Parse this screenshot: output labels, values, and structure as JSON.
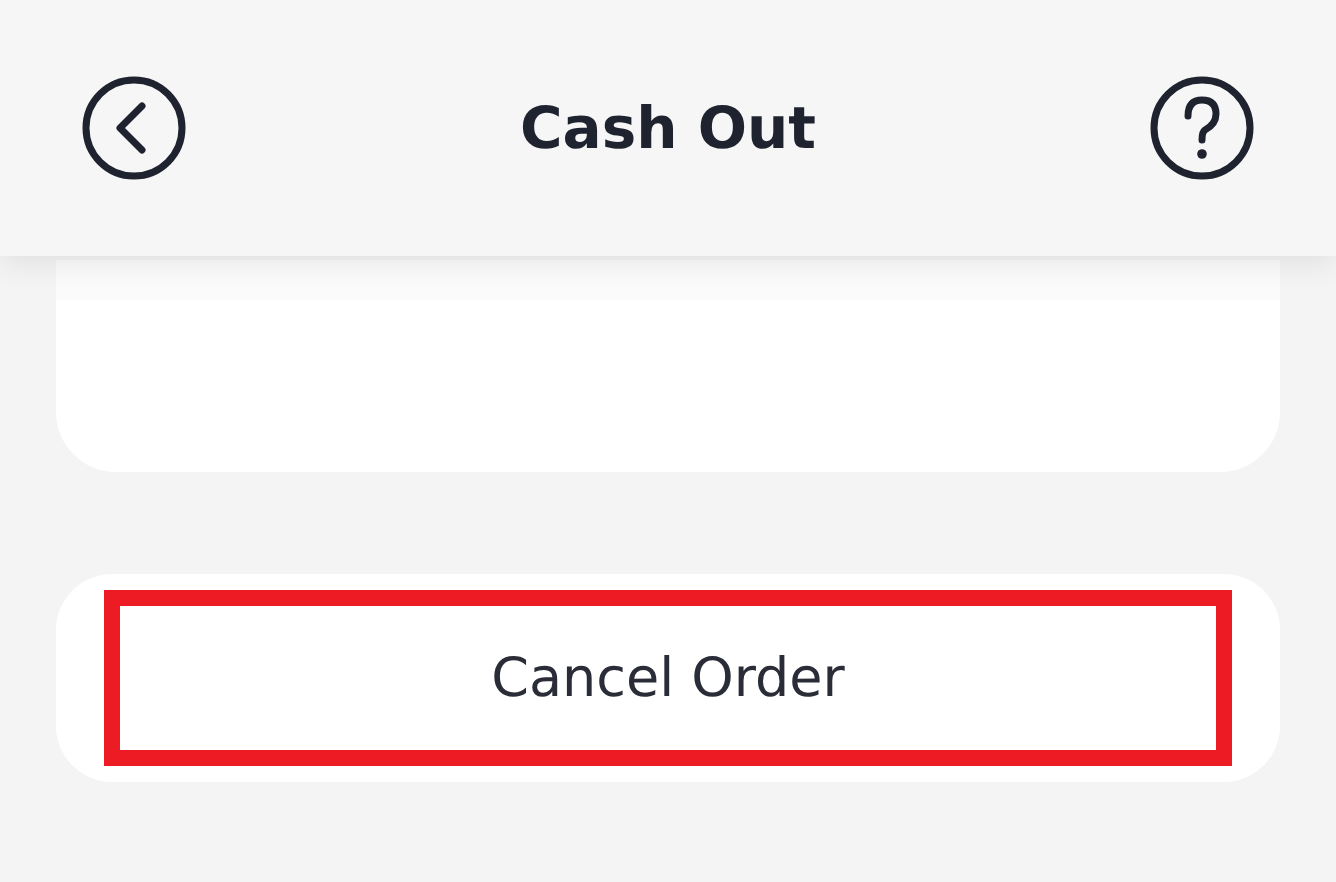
{
  "header": {
    "title": "Cash Out"
  },
  "actions": [
    {
      "label": "Cancel Order",
      "highlighted": true
    }
  ]
}
